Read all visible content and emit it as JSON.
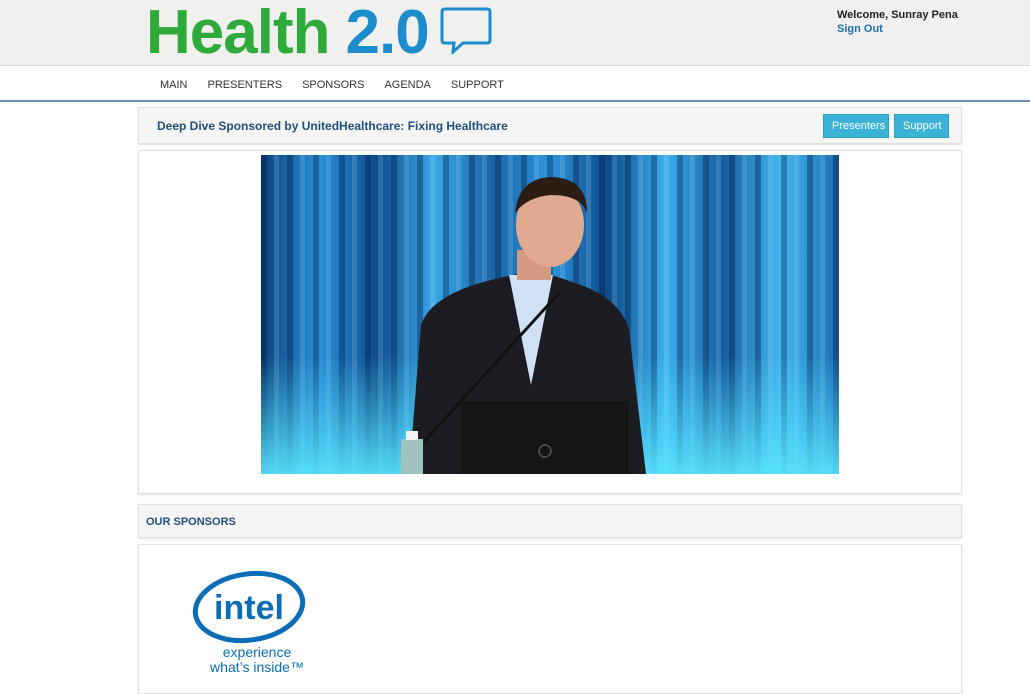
{
  "logo": {
    "word": "Health",
    "version": "2.0"
  },
  "user": {
    "welcome": "Welcome, Sunray Pena",
    "signout": "Sign Out"
  },
  "nav": [
    "MAIN",
    "PRESENTERS",
    "SPONSORS",
    "AGENDA",
    "SUPPORT"
  ],
  "session": {
    "title": "Deep Dive Sponsored by UnitedHealthcare: Fixing Healthcare",
    "buttons": {
      "presenters": "Presenters",
      "support": "Support"
    }
  },
  "sponsors": {
    "title": "OUR SPONSORS",
    "intel": {
      "name": "intel",
      "tagline1": "experience",
      "tagline2": "what’s inside™"
    }
  },
  "colors": {
    "logo_green": "#2eaa3a",
    "logo_blue": "#1d8ccc",
    "button": "#3bb3d6",
    "title": "#1f4f7a"
  }
}
